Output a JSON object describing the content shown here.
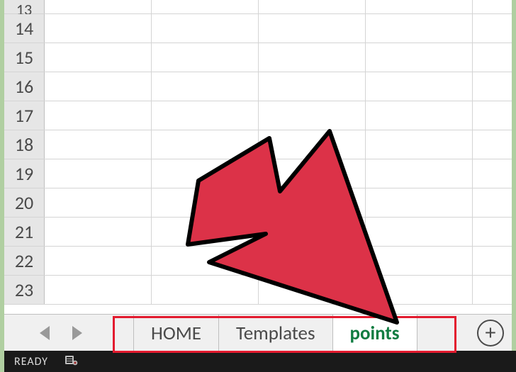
{
  "rows": [
    "13",
    "14",
    "15",
    "16",
    "17",
    "18",
    "19",
    "20",
    "21",
    "22",
    "23"
  ],
  "tabs": {
    "items": [
      {
        "label": "HOME",
        "active": false
      },
      {
        "label": "Templates",
        "active": false
      },
      {
        "label": "points",
        "active": true
      }
    ]
  },
  "addsheet": {
    "glyph": "+"
  },
  "status": {
    "text": "READY"
  }
}
